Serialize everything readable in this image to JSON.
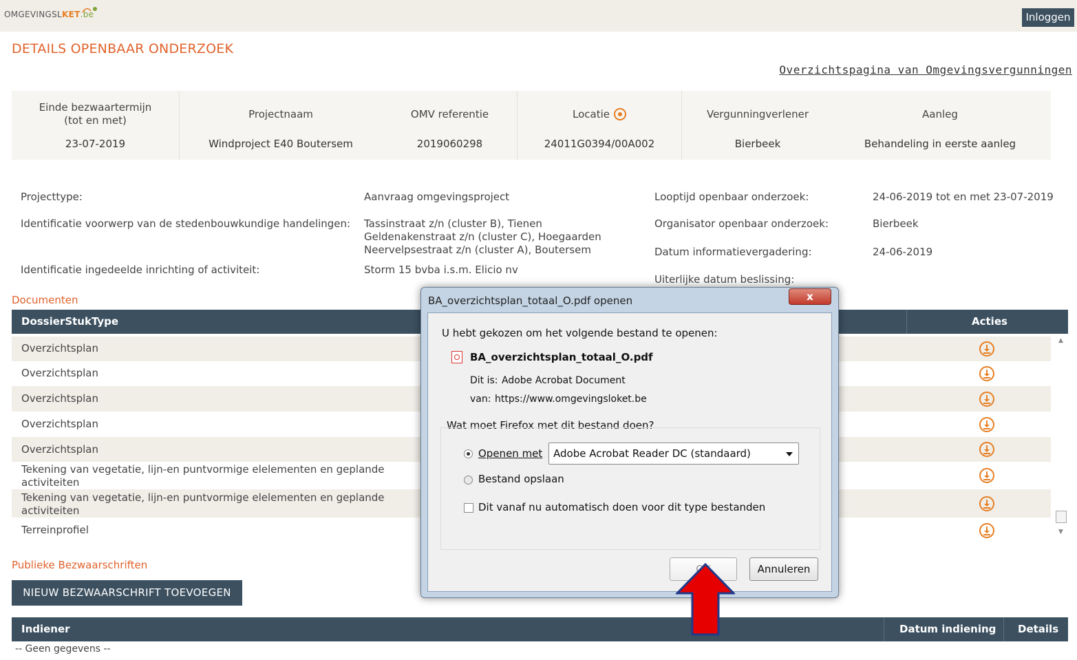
{
  "header": {
    "logo_text_a": "OMGEVINGSL",
    "logo_text_b": "KET",
    "logo_text_c": ".be",
    "login_label": "Inloggen"
  },
  "page_title": "DETAILS OPENBAAR ONDERZOEK",
  "overview_link": "Overzichtspagina van Omgevingsvergunningen",
  "summary": {
    "columns": [
      {
        "header": "Einde bezwaartermijn (tot en met)",
        "value": "23-07-2019"
      },
      {
        "header": "Projectnaam",
        "value": "Windproject E40 Boutersem"
      },
      {
        "header": "OMV referentie",
        "value": "2019060298"
      },
      {
        "header": "Locatie",
        "value": "24011G0394/00A002"
      },
      {
        "header": "Vergunningverlener",
        "value": "Bierbeek"
      },
      {
        "header": "Aanleg",
        "value": "Behandeling in eerste aanleg"
      }
    ]
  },
  "details": {
    "projecttype_label": "Projecttype:",
    "projecttype_value": "Aanvraag omgevingsproject",
    "ident_label": "Identificatie voorwerp van de stedenbouwkundige handelingen:",
    "ident_value_1": "Tassinstraat z/n (cluster B), Tienen",
    "ident_value_2": "Geldenakenstraat z/n (cluster C), Hoegaarden",
    "ident_value_3": "Neervelpsestraat z/n (cluster A), Boutersem",
    "inrichting_label": "Identificatie ingedeelde inrichting of activiteit:",
    "inrichting_value": "Storm 15 bvba i.s.m. Elicio nv",
    "looptijd_label": "Looptijd openbaar onderzoek:",
    "looptijd_value": "24-06-2019 tot en met 23-07-2019",
    "organisator_label": "Organisator openbaar onderzoek:",
    "organisator_value": "Bierbeek",
    "info_label": "Datum informatievergadering:",
    "info_value": "24-06-2019",
    "beslissing_label": "Uiterlijke datum beslissing:"
  },
  "documents": {
    "section_title": "Documenten",
    "col_type": "DossierStukType",
    "col_actions": "Acties",
    "rows": [
      {
        "line1": "Overzichtsplan",
        "line2": ""
      },
      {
        "line1": "Overzichtsplan",
        "line2": ""
      },
      {
        "line1": "Overzichtsplan",
        "line2": ""
      },
      {
        "line1": "Overzichtsplan",
        "line2": ""
      },
      {
        "line1": "Overzichtsplan",
        "line2": ""
      },
      {
        "line1": "Tekening van vegetatie, lijn-en puntvormige elelementen en geplande",
        "line2": "activiteiten"
      },
      {
        "line1": "Tekening van vegetatie, lijn-en puntvormige elelementen en geplande",
        "line2": "activiteiten"
      },
      {
        "line1": "Terreinprofiel",
        "line2": ""
      }
    ]
  },
  "objections": {
    "section_title": "Publieke Bezwaarschriften",
    "add_button": "NIEUW BEZWAARSCHRIFT TOEVOEGEN",
    "col_indiener": "Indiener",
    "col_datum": "Datum indiening",
    "col_details": "Details",
    "empty_text": "-- Geen gegevens --"
  },
  "dialog": {
    "title": "BA_overzichtsplan_totaal_O.pdf openen",
    "close_label": "x",
    "intro": "U hebt gekozen om het volgende bestand te openen:",
    "filename": "BA_overzichtsplan_totaal_O.pdf",
    "type_label": "Dit is:",
    "type_value": "Adobe Acrobat Document",
    "from_label": "van:",
    "from_value": "https://www.omgevingsloket.be",
    "question": "Wat moet Firefox met dit bestand doen?",
    "open_with_label": "Openen met",
    "open_with_app": "Adobe Acrobat Reader DC  (standaard)",
    "save_label": "Bestand opslaan",
    "auto_label": "Dit vanaf nu automatisch doen voor dit type bestanden",
    "ok_label": "OK",
    "cancel_label": "Annuleren"
  },
  "colors": {
    "accent_orange": "#e0622b",
    "header_slate": "#3c5060",
    "annotation_red": "#e60000",
    "annotation_outline": "#1f3a8a"
  }
}
